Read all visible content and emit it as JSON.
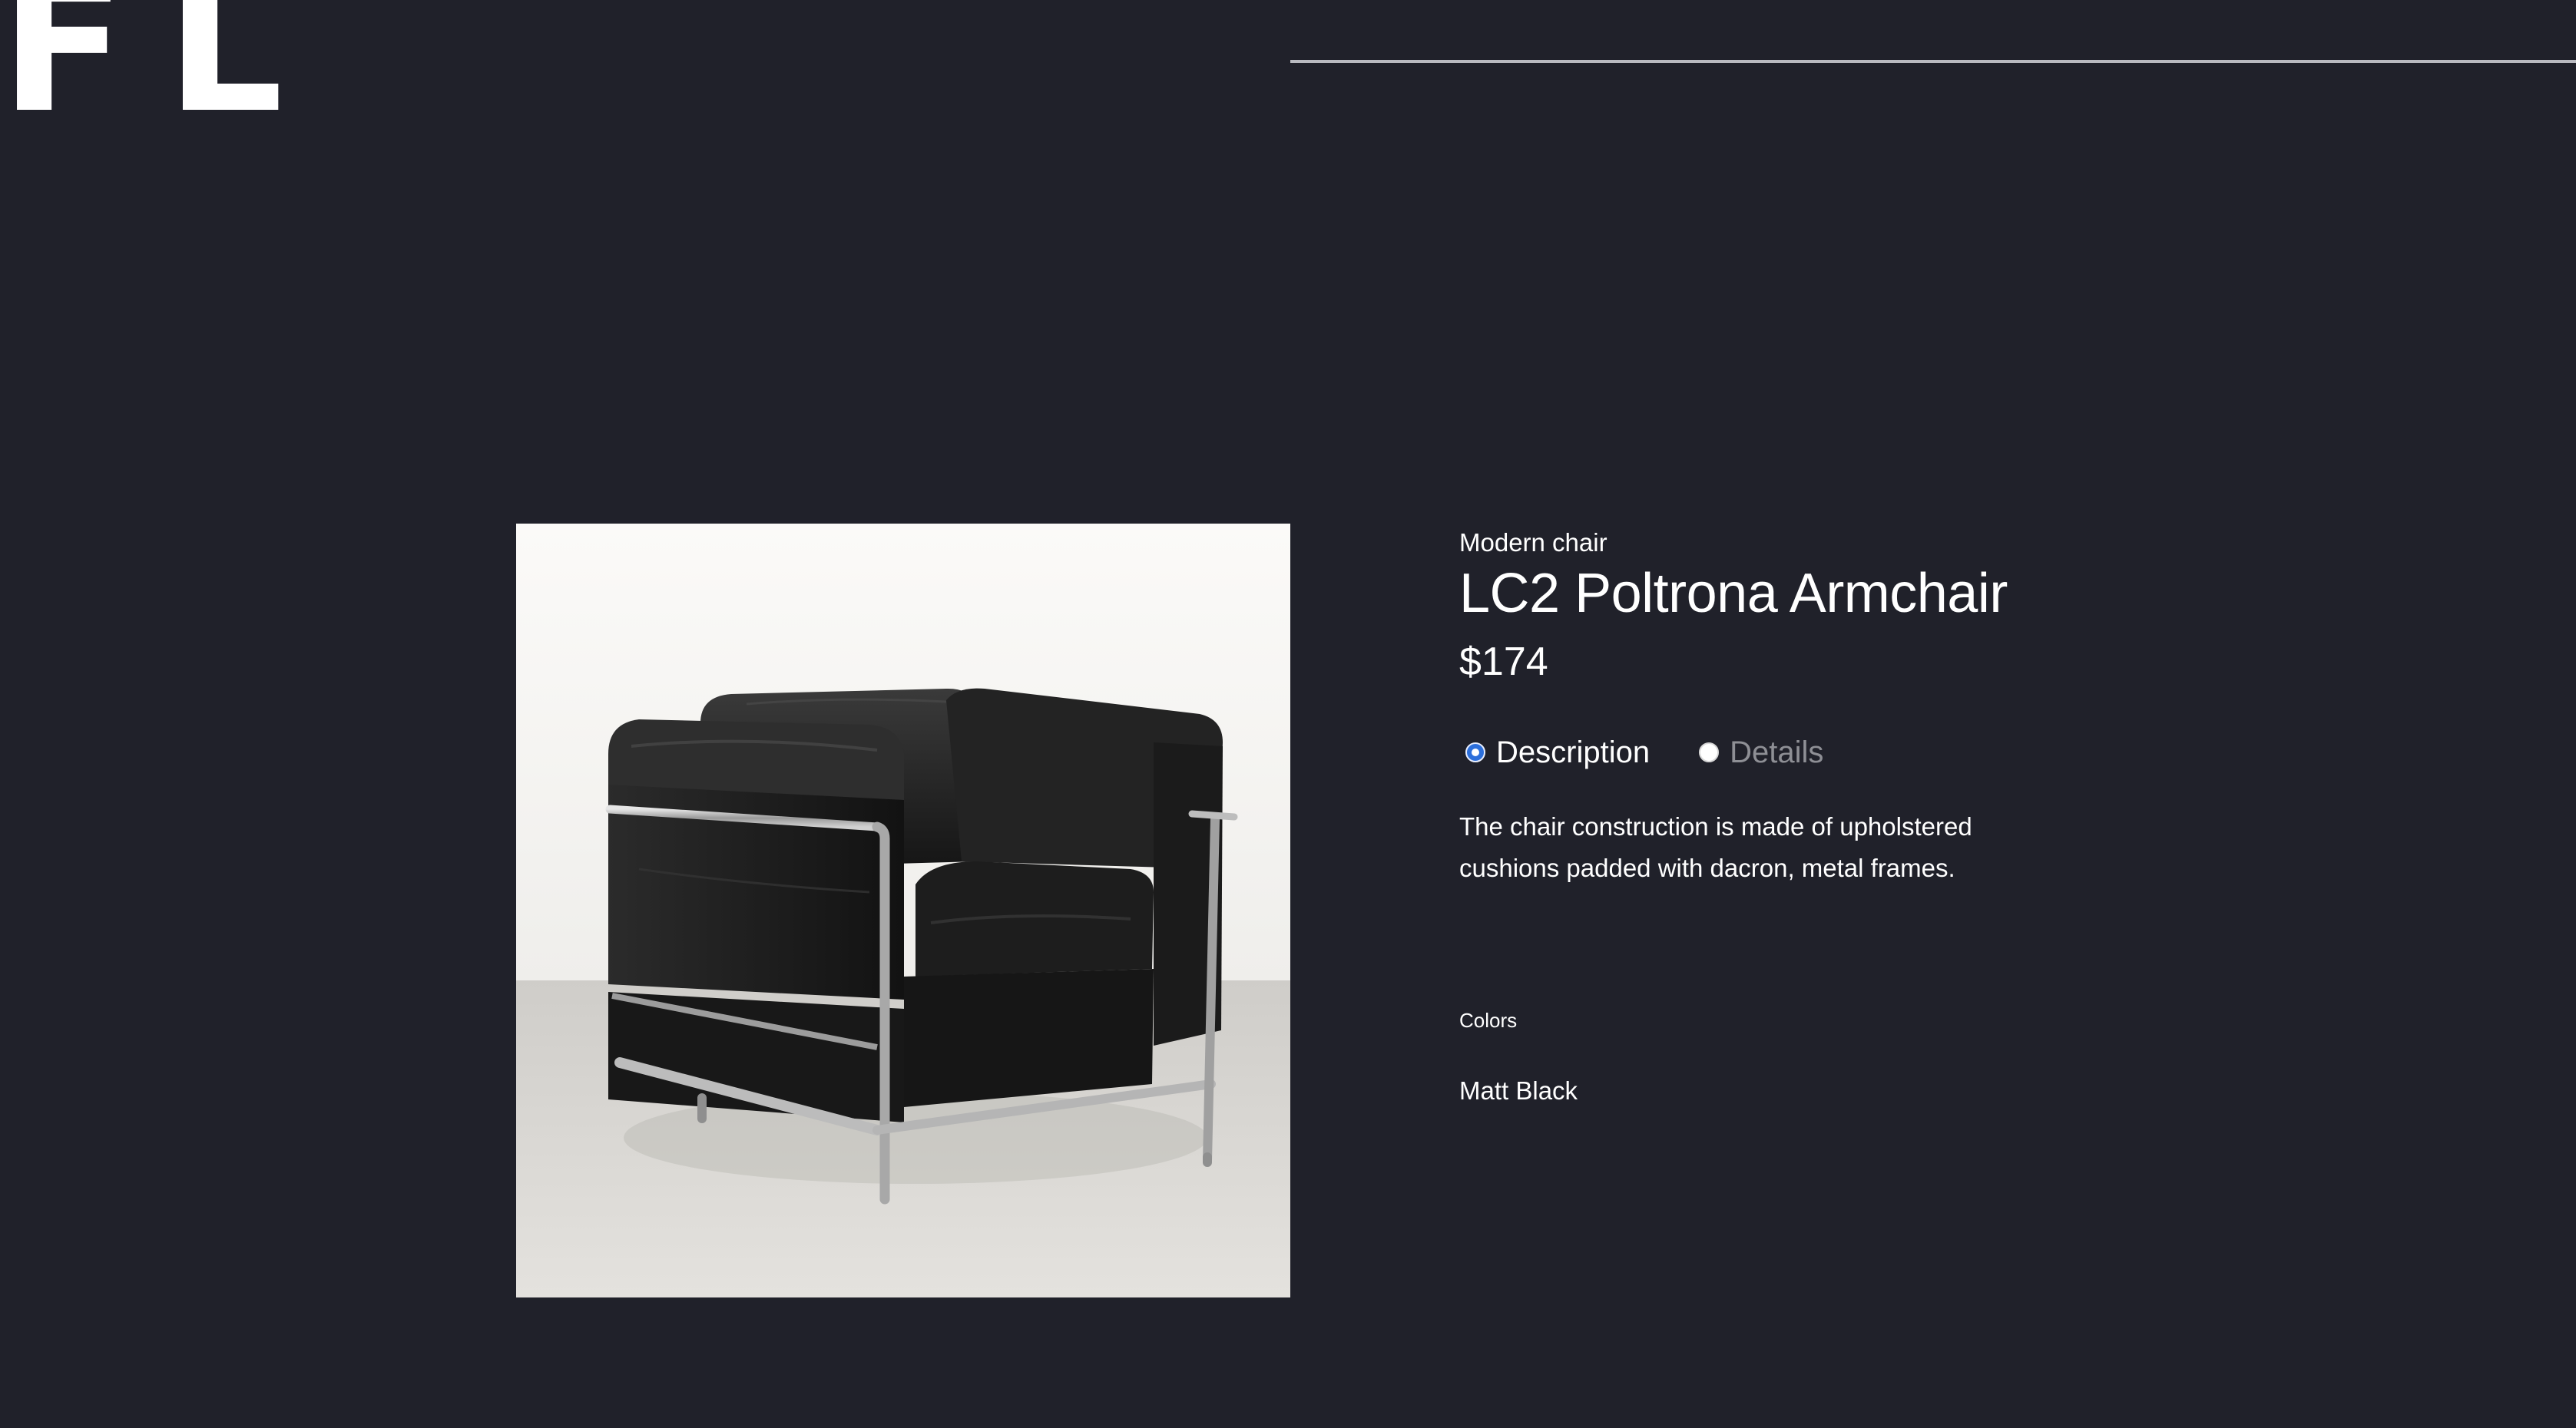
{
  "header": {
    "logo_text": "FL"
  },
  "product": {
    "image_subject": "black leather armchair with chrome tubular frame",
    "category": "Modern chair",
    "name": "LC2 Poltrona Armchair",
    "price": "$174",
    "tabs": [
      {
        "label": "Description",
        "selected": true
      },
      {
        "label": "Details",
        "selected": false
      }
    ],
    "description": "The chair construction is made of upholstered cushions padded with dacron, metal frames.",
    "colors_heading": "Colors",
    "color_value": "Matt Black"
  },
  "colors": {
    "background": "#20212a",
    "text": "#ffffff",
    "muted_text": "#8e8f95",
    "radio_accent": "#2c6fdb"
  }
}
